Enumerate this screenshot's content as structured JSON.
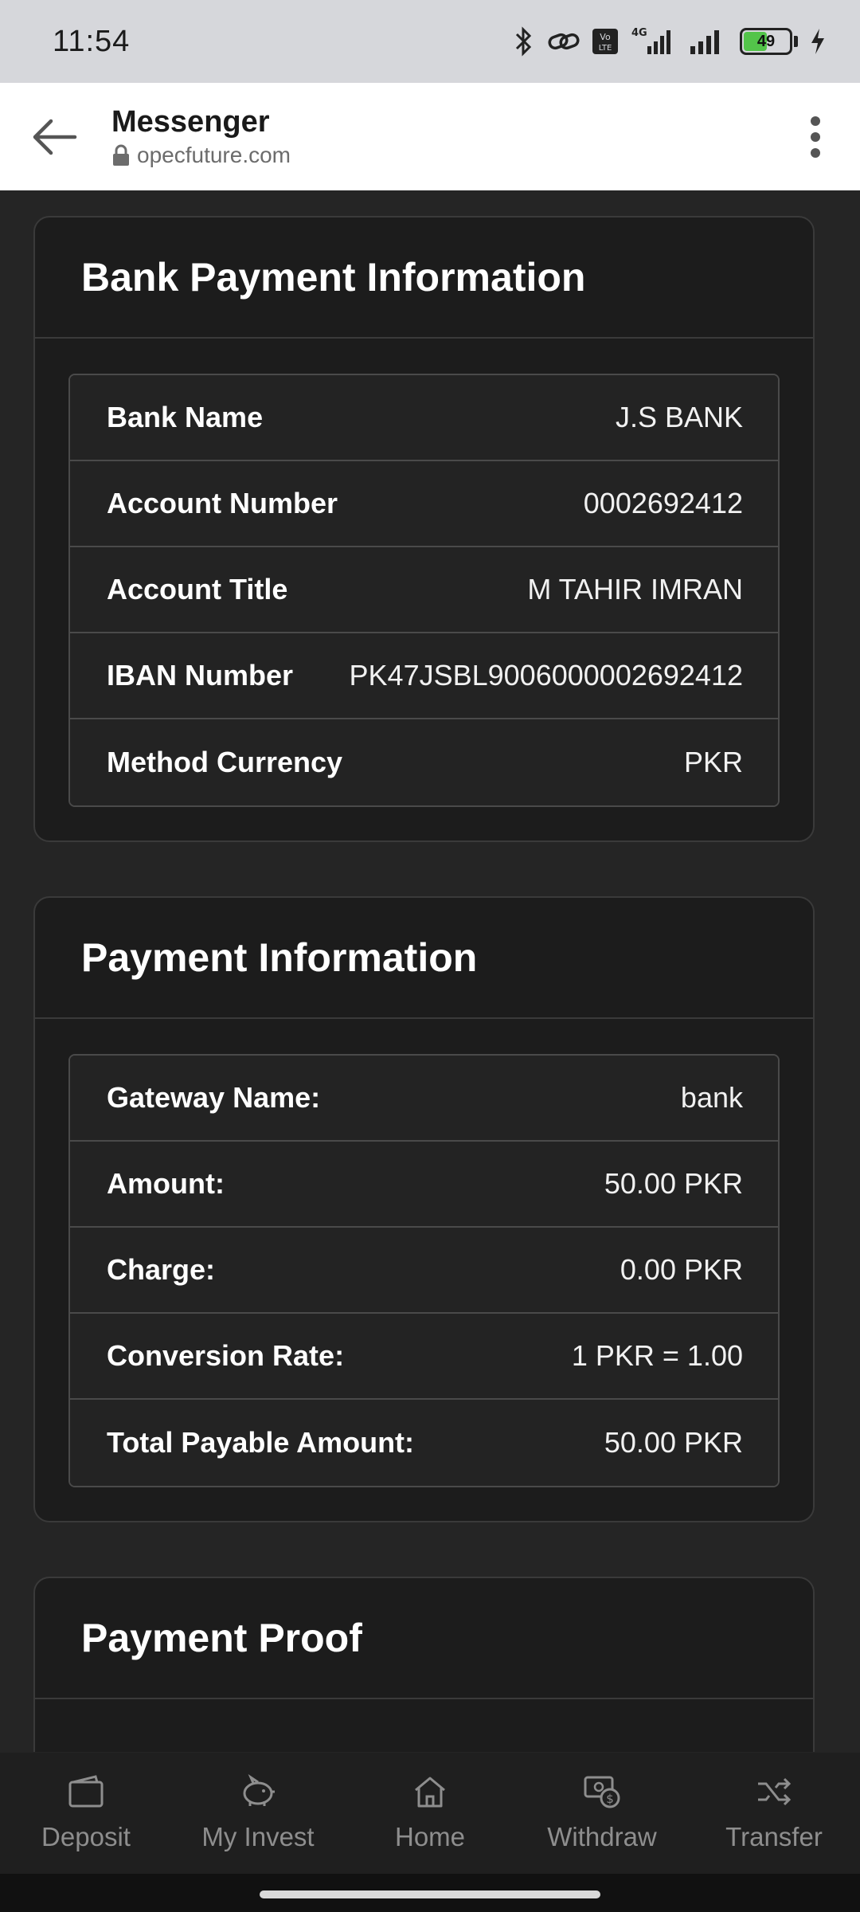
{
  "status_bar": {
    "time": "11:54",
    "battery": "49"
  },
  "app_bar": {
    "title": "Messenger",
    "url": "opecfuture.com"
  },
  "bank_card": {
    "title": "Bank Payment Information",
    "rows": [
      {
        "label": "Bank Name",
        "value": "J.S BANK"
      },
      {
        "label": "Account Number",
        "value": "0002692412"
      },
      {
        "label": "Account Title",
        "value": "M TAHIR IMRAN"
      },
      {
        "label": "IBAN Number",
        "value": "PK47JSBL9006000002692412"
      },
      {
        "label": "Method Currency",
        "value": "PKR"
      }
    ]
  },
  "payment_card": {
    "title": "Payment Information",
    "rows": [
      {
        "label": "Gateway Name:",
        "value": "bank"
      },
      {
        "label": "Amount:",
        "value": "50.00 PKR"
      },
      {
        "label": "Charge:",
        "value": "0.00 PKR"
      },
      {
        "label": "Conversion Rate:",
        "value": "1 PKR = 1.00"
      },
      {
        "label": "Total Payable Amount:",
        "value": "50.00 PKR"
      }
    ]
  },
  "proof_card": {
    "title": "Payment Proof"
  },
  "bottom_nav": {
    "items": [
      {
        "label": "Deposit",
        "icon": "wallet-icon"
      },
      {
        "label": "My Invest",
        "icon": "piggy-bank-icon"
      },
      {
        "label": "Home",
        "icon": "home-icon"
      },
      {
        "label": "Withdraw",
        "icon": "cash-icon"
      },
      {
        "label": "Transfer",
        "icon": "shuffle-icon"
      }
    ]
  }
}
